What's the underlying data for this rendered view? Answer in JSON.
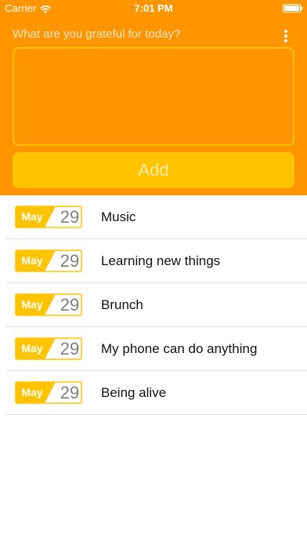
{
  "status_bar": {
    "carrier": "Carrier",
    "time": "7:01 PM",
    "wifi_icon": "wifi-icon",
    "battery_icon": "battery-icon"
  },
  "composer": {
    "prompt": "What are you grateful for today?",
    "more_icon": "more-vertical-icon",
    "input_value": "",
    "add_label": "Add"
  },
  "entries": [
    {
      "month": "May",
      "day": "29",
      "text": "Music"
    },
    {
      "month": "May",
      "day": "29",
      "text": "Learning new things"
    },
    {
      "month": "May",
      "day": "29",
      "text": "Brunch"
    },
    {
      "month": "May",
      "day": "29",
      "text": "My phone can do anything"
    },
    {
      "month": "May",
      "day": "29",
      "text": "Being alive"
    }
  ],
  "colors": {
    "header_background": "#ff9500",
    "accent_yellow": "#ffc300",
    "divider": "#e2e2e2"
  }
}
